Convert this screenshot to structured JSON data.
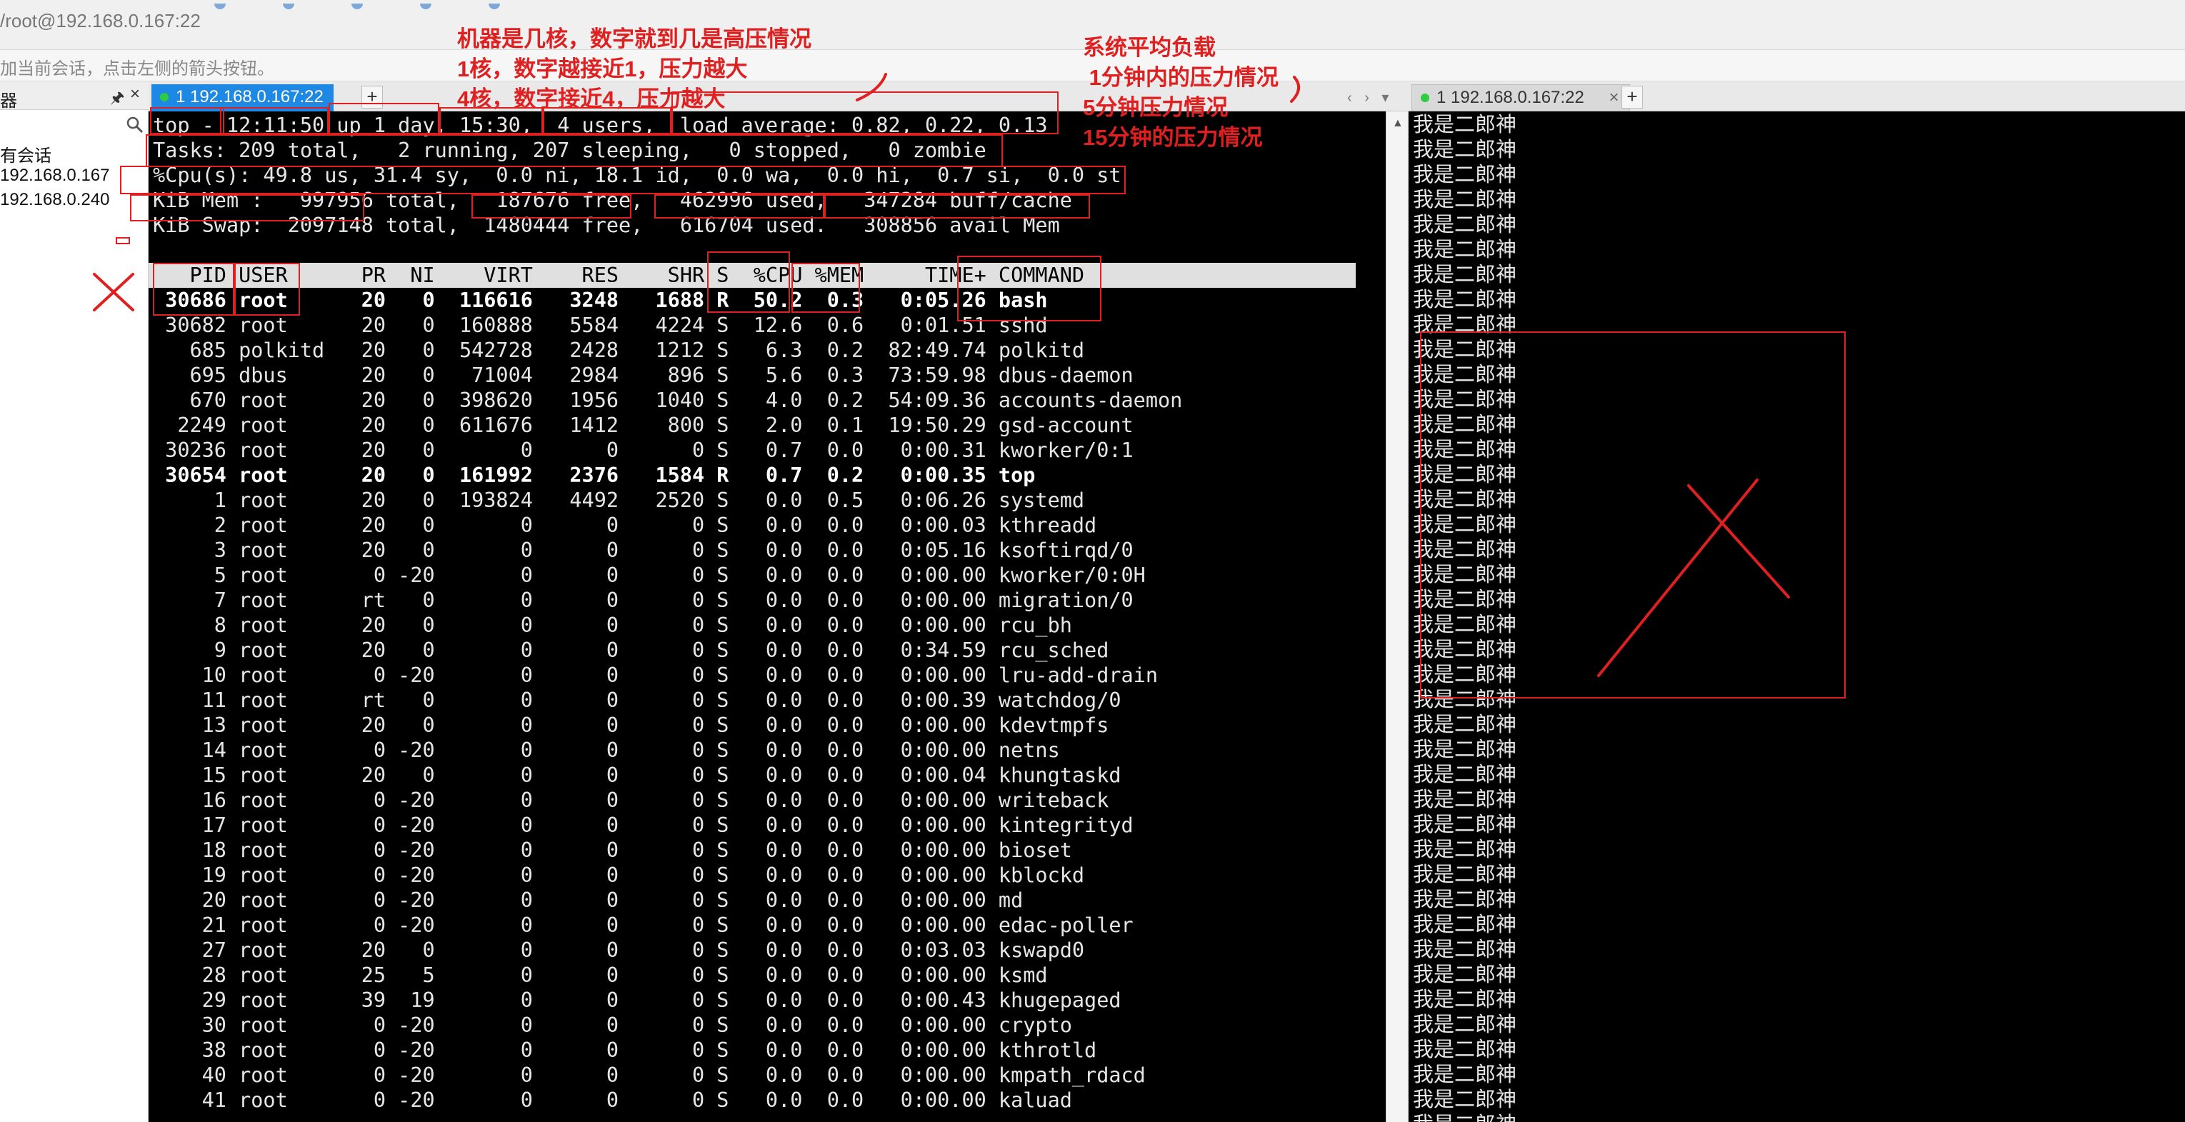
{
  "window": {
    "title": "/root@192.168.0.167:22"
  },
  "hint_bar": {
    "text": "加当前会话，点击左侧的箭头按钮。"
  },
  "left_panel": {
    "title": "器",
    "pin_icon": "pin-icon",
    "close_glyph": "×",
    "search_icon": "search-icon",
    "group_label": "有会话",
    "sessions": [
      "192.168.0.167",
      "192.168.0.240"
    ]
  },
  "tabs": {
    "left": {
      "label": "1 192.168.0.167:22",
      "plus": "+"
    },
    "right": {
      "label": "1 192.168.0.167:22",
      "close": "×",
      "plus": "+"
    },
    "arrows": "‹ › ▾"
  },
  "terminal_left": {
    "summary": [
      "top - 12:11:50 up 1 day, 15:30,  4 users,  load average: 0.82, 0.22, 0.13",
      "Tasks: 209 total,   2 running, 207 sleeping,   0 stopped,   0 zombie",
      "%Cpu(s): 49.8 us, 31.4 sy,  0.0 ni, 18.1 id,  0.0 wa,  0.0 hi,  0.7 si,  0.0 st",
      "KiB Mem :   997956 total,   187676 free,   462996 used,   347284 buff/cache",
      "KiB Swap:  2097148 total,  1480444 free,   616704 used.   308856 avail Mem"
    ],
    "header": "   PID USER      PR  NI    VIRT    RES    SHR S  %CPU %MEM     TIME+ COMMAND",
    "rows": [
      {
        "text": " 30686 root      20   0  116616   3248   1688 R  50.2  0.3   0:05.26 bash",
        "bold": true
      },
      {
        "text": " 30682 root      20   0  160888   5584   4224 S  12.6  0.6   0:01.51 sshd",
        "bold": false
      },
      {
        "text": "   685 polkitd   20   0  542728   2428   1212 S   6.3  0.2  82:49.74 polkitd",
        "bold": false
      },
      {
        "text": "   695 dbus      20   0   71004   2984    896 S   5.6  0.3  73:59.98 dbus-daemon",
        "bold": false
      },
      {
        "text": "   670 root      20   0  398620   1956   1040 S   4.0  0.2  54:09.36 accounts-daemon",
        "bold": false
      },
      {
        "text": "  2249 root      20   0  611676   1412    800 S   2.0  0.1  19:50.29 gsd-account",
        "bold": false
      },
      {
        "text": " 30236 root      20   0       0      0      0 S   0.7  0.0   0:00.31 kworker/0:1",
        "bold": false
      },
      {
        "text": " 30654 root      20   0  161992   2376   1584 R   0.7  0.2   0:00.35 top",
        "bold": true
      },
      {
        "text": "     1 root      20   0  193824   4492   2520 S   0.0  0.5   0:06.26 systemd",
        "bold": false
      },
      {
        "text": "     2 root      20   0       0      0      0 S   0.0  0.0   0:00.03 kthreadd",
        "bold": false
      },
      {
        "text": "     3 root      20   0       0      0      0 S   0.0  0.0   0:05.16 ksoftirqd/0",
        "bold": false
      },
      {
        "text": "     5 root       0 -20       0      0      0 S   0.0  0.0   0:00.00 kworker/0:0H",
        "bold": false
      },
      {
        "text": "     7 root      rt   0       0      0      0 S   0.0  0.0   0:00.00 migration/0",
        "bold": false
      },
      {
        "text": "     8 root      20   0       0      0      0 S   0.0  0.0   0:00.00 rcu_bh",
        "bold": false
      },
      {
        "text": "     9 root      20   0       0      0      0 S   0.0  0.0   0:34.59 rcu_sched",
        "bold": false
      },
      {
        "text": "    10 root       0 -20       0      0      0 S   0.0  0.0   0:00.00 lru-add-drain",
        "bold": false
      },
      {
        "text": "    11 root      rt   0       0      0      0 S   0.0  0.0   0:00.39 watchdog/0",
        "bold": false
      },
      {
        "text": "    13 root      20   0       0      0      0 S   0.0  0.0   0:00.00 kdevtmpfs",
        "bold": false
      },
      {
        "text": "    14 root       0 -20       0      0      0 S   0.0  0.0   0:00.00 netns",
        "bold": false
      },
      {
        "text": "    15 root      20   0       0      0      0 S   0.0  0.0   0:00.04 khungtaskd",
        "bold": false
      },
      {
        "text": "    16 root       0 -20       0      0      0 S   0.0  0.0   0:00.00 writeback",
        "bold": false
      },
      {
        "text": "    17 root       0 -20       0      0      0 S   0.0  0.0   0:00.00 kintegrityd",
        "bold": false
      },
      {
        "text": "    18 root       0 -20       0      0      0 S   0.0  0.0   0:00.00 bioset",
        "bold": false
      },
      {
        "text": "    19 root       0 -20       0      0      0 S   0.0  0.0   0:00.00 kblockd",
        "bold": false
      },
      {
        "text": "    20 root       0 -20       0      0      0 S   0.0  0.0   0:00.00 md",
        "bold": false
      },
      {
        "text": "    21 root       0 -20       0      0      0 S   0.0  0.0   0:00.00 edac-poller",
        "bold": false
      },
      {
        "text": "    27 root      20   0       0      0      0 S   0.0  0.0   0:03.03 kswapd0",
        "bold": false
      },
      {
        "text": "    28 root      25   5       0      0      0 S   0.0  0.0   0:00.00 ksmd",
        "bold": false
      },
      {
        "text": "    29 root      39  19       0      0      0 S   0.0  0.0   0:00.43 khugepaged",
        "bold": false
      },
      {
        "text": "    30 root       0 -20       0      0      0 S   0.0  0.0   0:00.00 crypto",
        "bold": false
      },
      {
        "text": "    38 root       0 -20       0      0      0 S   0.0  0.0   0:00.00 kthrotld",
        "bold": false
      },
      {
        "text": "    40 root       0 -20       0      0      0 S   0.0  0.0   0:00.00 kmpath_rdacd",
        "bold": false
      },
      {
        "text": "    41 root       0 -20       0      0      0 S   0.0  0.0   0:00.00 kaluad",
        "bold": false
      }
    ]
  },
  "terminal_right": {
    "line_text": "我是二郎神",
    "line_count": 42
  },
  "annotations": {
    "note_machine": [
      "机器是几核，数字就到几是高压情况",
      "1核，数字越接近1，压力越大",
      "4核，数字接近4，压力越大"
    ],
    "note_load": [
      "系统平均负载",
      " 1分钟内的压力情况",
      "5分钟压力情况",
      "15分钟的压力情况"
    ],
    "color": "#e02020"
  }
}
